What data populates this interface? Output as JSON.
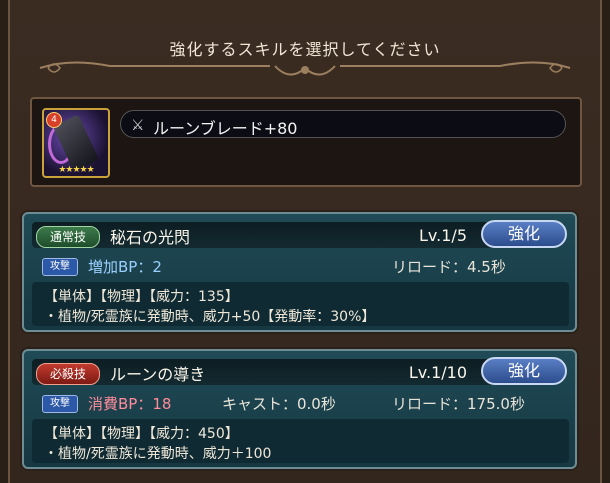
{
  "header": {
    "title": "強化するスキルを選択してください"
  },
  "item": {
    "rank_badge": "4",
    "stars": "★★★★★",
    "name_icon": "crossed-swords-icon",
    "name": "ルーンブレード+80"
  },
  "skills": [
    {
      "type_label": "通常技",
      "type_color": "#2f6b3c",
      "name": "秘石の光閃",
      "level": "Lv.1/5",
      "button": "強化",
      "tag": "攻撃",
      "bp": "増加BP：2",
      "cast": "",
      "reload": "リロード：4.5秒",
      "line1": "【単体】【物理】【威力：135】",
      "line2": "・植物/死霊族に発動時、威力+50【発動率：30%】"
    },
    {
      "type_label": "必殺技",
      "type_color": "#a52a20",
      "name": "ルーンの導き",
      "level": "Lv.1/10",
      "button": "強化",
      "tag": "攻撃",
      "bp": "消費BP：18",
      "cast": "キャスト：0.0秒",
      "reload": "リロード：175.0秒",
      "line1": "【単体】【物理】【威力：450】",
      "line2": "・植物/死霊族に発動時、威力＋100"
    }
  ]
}
